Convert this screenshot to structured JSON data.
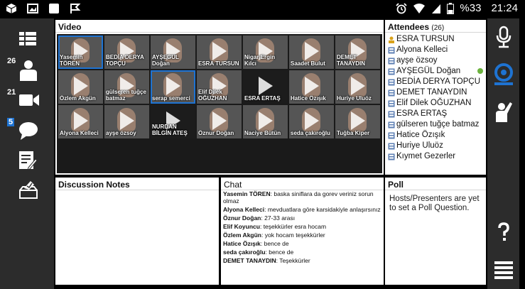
{
  "status_bar": {
    "battery": "%33",
    "time": "21:24"
  },
  "left_sidebar": {
    "badges": {
      "attendees": "26",
      "cameras": "21",
      "chat": "5"
    }
  },
  "video": {
    "title": "Video",
    "tiles": [
      {
        "name": "Yasemin TÖREN",
        "selected": true,
        "dark": false
      },
      {
        "name": "BEDİA DERYA TOPÇU",
        "selected": false,
        "dark": false
      },
      {
        "name": "AYŞEGÜL Doğan",
        "selected": false,
        "dark": false
      },
      {
        "name": "ESRA TURSUN",
        "selected": false,
        "dark": false
      },
      {
        "name": "Nigar Ergin Kılcı",
        "selected": false,
        "dark": false
      },
      {
        "name": "Saadet Bulut",
        "selected": false,
        "dark": false
      },
      {
        "name": "DEMET TANAYDIN",
        "selected": false,
        "dark": false
      },
      {
        "name": "Özlem Akgün",
        "selected": false,
        "dark": false
      },
      {
        "name": "gülseren tuğçe batmaz",
        "selected": false,
        "dark": false
      },
      {
        "name": "serap semerci",
        "selected": true,
        "dark": false
      },
      {
        "name": "Elif Dilek OĞUZHAN",
        "selected": false,
        "dark": false
      },
      {
        "name": "ESRA ERTAŞ",
        "selected": false,
        "dark": true
      },
      {
        "name": "Hatice Özışık",
        "selected": false,
        "dark": false
      },
      {
        "name": "Huriye Uluöz",
        "selected": false,
        "dark": false
      },
      {
        "name": "Alyona Kelleci",
        "selected": false,
        "dark": false
      },
      {
        "name": "ayşe özsoy",
        "selected": false,
        "dark": false
      },
      {
        "name": "NURDAN BİLGİN ATEŞ",
        "selected": false,
        "dark": true
      },
      {
        "name": "Öznur Doğan",
        "selected": false,
        "dark": false
      },
      {
        "name": "Naciye Bütün",
        "selected": false,
        "dark": false
      },
      {
        "name": "seda çakıroğlu",
        "selected": false,
        "dark": false
      },
      {
        "name": "Tuğba Kiper",
        "selected": false,
        "dark": false
      }
    ]
  },
  "attendees": {
    "title": "Attendees",
    "count": "(26)",
    "items": [
      {
        "name": "ESRA TURSUN",
        "role": "host",
        "status": false
      },
      {
        "name": "Alyona Kelleci",
        "role": "participant",
        "status": false
      },
      {
        "name": "ayşe özsoy",
        "role": "participant",
        "status": false
      },
      {
        "name": "AYŞEGÜL Doğan",
        "role": "participant",
        "status": true
      },
      {
        "name": "BEDİA DERYA TOPÇU",
        "role": "participant",
        "status": false
      },
      {
        "name": "DEMET TANAYDIN",
        "role": "participant",
        "status": false
      },
      {
        "name": "Elif Dilek OĞUZHAN",
        "role": "participant",
        "status": false
      },
      {
        "name": "ESRA ERTAŞ",
        "role": "participant",
        "status": false
      },
      {
        "name": "gülseren tuğçe  batmaz",
        "role": "participant",
        "status": false
      },
      {
        "name": "Hatice Özışık",
        "role": "participant",
        "status": false
      },
      {
        "name": "Huriye Uluöz",
        "role": "participant",
        "status": false
      },
      {
        "name": "Kıymet Gezerler",
        "role": "participant",
        "status": false
      }
    ]
  },
  "notes": {
    "title": "Discussion Notes"
  },
  "chat": {
    "title": "Chat",
    "messages": [
      {
        "sender": "Yasemin TÖREN",
        "text": "baska siniflara da gorev veriniz sorun olmaz"
      },
      {
        "sender": "Alyona Kelleci",
        "text": "mevduatlara göre karsidakiyle anlaşırsınız"
      },
      {
        "sender": "Öznur Doğan",
        "text": "27-33 arası"
      },
      {
        "sender": "Elif Koyuncu",
        "text": "teşekkürler esra hocam"
      },
      {
        "sender": "Özlem Akgün",
        "text": "yok hocam teşekkürler"
      },
      {
        "sender": "Hatice Özışık",
        "text": "bence de"
      },
      {
        "sender": "seda çakıroğlu",
        "text": "bence de"
      },
      {
        "sender": "DEMET TANAYDIN",
        "text": "Teşekkürler"
      }
    ]
  },
  "poll": {
    "title": "Poll",
    "message": "Hosts/Presenters are yet to set a Poll Question."
  },
  "colors": {
    "accent": "#1e73d2",
    "sidebar": "#2c2c2c",
    "online": "#6cb33e"
  }
}
